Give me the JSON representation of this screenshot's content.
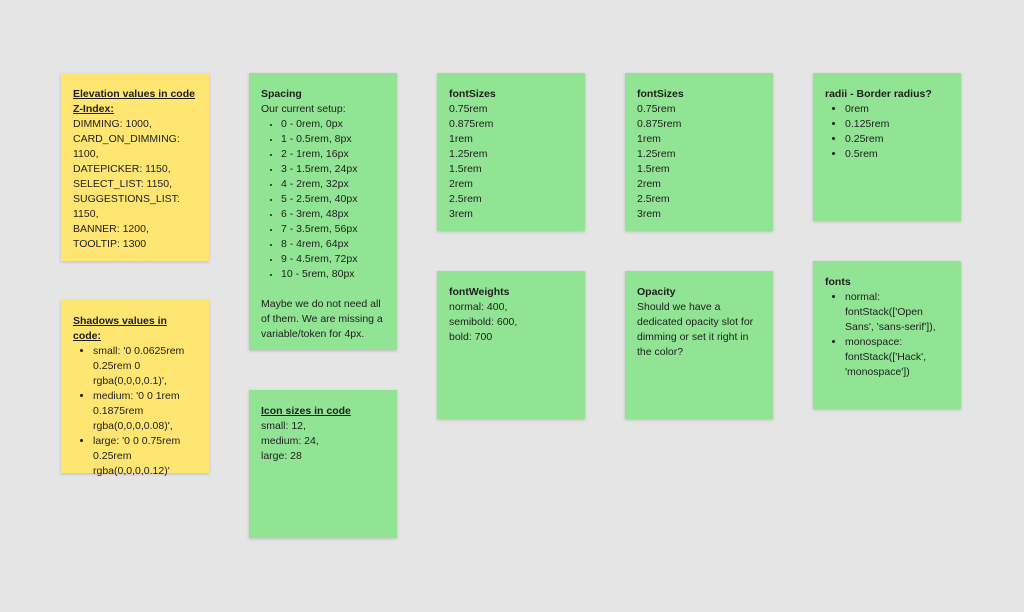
{
  "notes": {
    "elevation": {
      "color": "#ffe672",
      "title": "Elevation values in code",
      "subtitle": "Z-Index:",
      "lines": [
        "DIMMING: 1000,",
        "CARD_ON_DIMMING:",
        "1100,",
        "DATEPICKER: 1150,",
        "SELECT_LIST: 1150,",
        "SUGGESTIONS_LIST:",
        "1150,",
        "BANNER: 1200,",
        "TOOLTIP: 1300"
      ]
    },
    "shadows": {
      "color": "#ffe672",
      "title": "Shadows values in code:",
      "items": [
        "small: '0 0.0625rem 0.25rem 0 rgba(0,0,0,0.1)',",
        "medium: '0 0 1rem 0.1875rem rgba(0,0,0,0.08)',",
        "large: '0 0 0.75rem 0.25rem rgba(0,0,0,0.12)'"
      ]
    },
    "spacing": {
      "color": "#92e495",
      "title": "Spacing",
      "intro": "Our current setup:",
      "items": [
        "0 - 0rem, 0px",
        "1 - 0.5rem, 8px",
        "2 - 1rem, 16px",
        "3 - 1.5rem, 24px",
        "4 - 2rem, 32px",
        "5 - 2.5rem, 40px",
        "6 - 3rem, 48px",
        "7 - 3.5rem, 56px",
        "8 - 4rem, 64px",
        "9 - 4.5rem, 72px",
        "10 - 5rem, 80px"
      ],
      "footer": "Maybe we do not need all of them. We are missing a variable/token for 4px."
    },
    "icon_sizes": {
      "color": "#92e495",
      "title": "Icon sizes in code",
      "lines": [
        "small: 12,",
        "medium: 24,",
        "large: 28"
      ]
    },
    "font_sizes_1": {
      "title": "fontSizes",
      "lines": [
        "0.75rem",
        "0.875rem",
        "1rem",
        "1.25rem",
        "1.5rem",
        "2rem",
        "2.5rem",
        "3rem"
      ]
    },
    "font_sizes_2": {
      "title": "fontSizes",
      "lines": [
        "0.75rem",
        "0.875rem",
        "1rem",
        "1.25rem",
        "1.5rem",
        "2rem",
        "2.5rem",
        "3rem"
      ]
    },
    "font_weights": {
      "title": "fontWeights",
      "lines": [
        "normal: 400,",
        "semibold: 600,",
        "bold: 700"
      ]
    },
    "opacity": {
      "title": "Opacity",
      "text": "Should we have a dedicated opacity slot for dimming or set it right in the color?"
    },
    "radii": {
      "title": "radii - Border radius?",
      "items": [
        "0rem",
        "0.125rem",
        "0.25rem",
        "0.5rem"
      ]
    },
    "fonts": {
      "title": "fonts",
      "items": [
        "normal: fontStack(['Open Sans', 'sans-serif']),",
        "monospace: fontStack(['Hack', 'monospace'])"
      ]
    }
  }
}
